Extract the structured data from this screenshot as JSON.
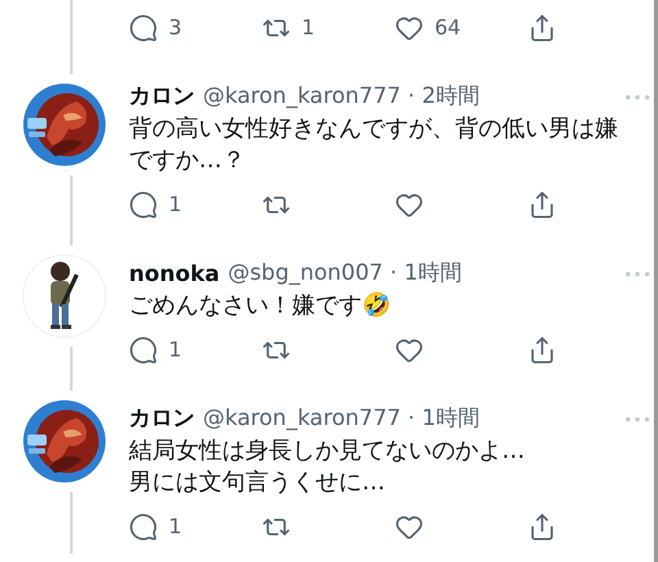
{
  "top_actions": [
    {
      "kind": "reply",
      "count": "3"
    },
    {
      "kind": "retweet",
      "count": "1"
    },
    {
      "kind": "like",
      "count": "64"
    },
    {
      "kind": "share"
    }
  ],
  "tweets": [
    {
      "avatar": {
        "kind": "badge"
      },
      "name": "カロン",
      "meta": "@karon_karon777 · 2時間",
      "text": "背の高い女性好きなんですが、背の低い男は嫌ですか…？",
      "actions": [
        {
          "kind": "reply",
          "count": "1"
        },
        {
          "kind": "retweet"
        },
        {
          "kind": "like"
        },
        {
          "kind": "share"
        }
      ]
    },
    {
      "avatar": {
        "kind": "figure"
      },
      "name": "nonoka",
      "meta": "@sbg_non007 · 1時間",
      "text": "ごめんなさい！嫌です🤣",
      "actions": [
        {
          "kind": "reply",
          "count": "1"
        },
        {
          "kind": "retweet"
        },
        {
          "kind": "like"
        },
        {
          "kind": "share"
        }
      ]
    },
    {
      "avatar": {
        "kind": "badge"
      },
      "name": "カロン",
      "meta": "@karon_karon777 · 1時間",
      "text": "結局女性は身長しか見てないのかよ…\n男には文句言うくせに…",
      "actions": [
        {
          "kind": "reply",
          "count": "1"
        },
        {
          "kind": "retweet"
        },
        {
          "kind": "like"
        },
        {
          "kind": "share"
        }
      ]
    }
  ]
}
